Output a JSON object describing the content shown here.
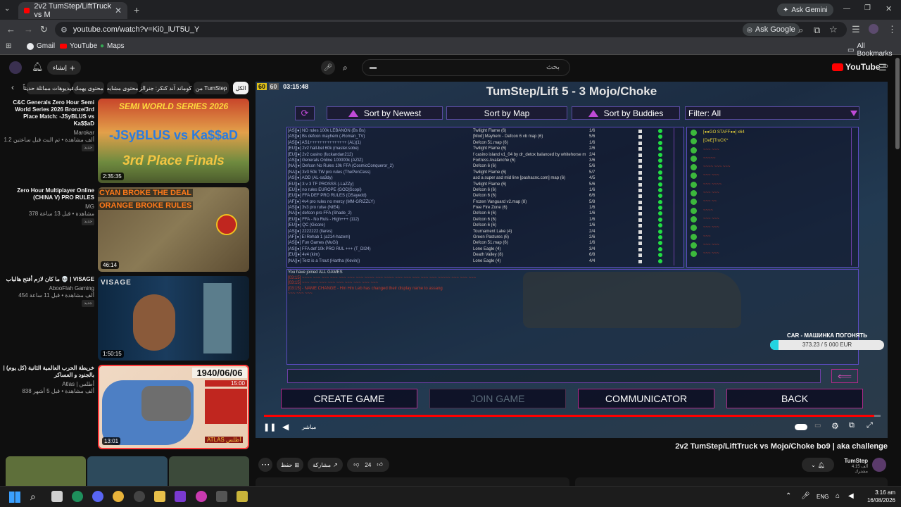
{
  "browser": {
    "tab_title": "2v2 TumStep/LiftTruck vs M",
    "tab_close": "✕",
    "new_tab": "+",
    "ask_gemini": "Ask Gemini",
    "url": "youtube.com/watch?v=Ki0_lUT5U_Y",
    "ask_google": "Ask Google",
    "bookmarks": [
      "Gmail",
      "YouTube",
      "Maps"
    ],
    "all_bookmarks": "All Bookmarks",
    "window_controls": [
      "—",
      "❐",
      "✕"
    ]
  },
  "youtube": {
    "create_label": "إنشاء",
    "search_placeholder": "بحث",
    "logo_text": "YouTube",
    "logo_sup": "JO",
    "chips": [
      "الكل",
      "من TumStep",
      "كوماند آند كنكر: جنرالز",
      "محتوى مشابه",
      "محتوى يهمك",
      "فيديوهات مماثلة حديثاً"
    ],
    "recommendations": [
      {
        "title": "C&C Generals Zero Hour Semi World Series 2026 Bronze/3rd Place Match: -JSyBLUS vs Ka$$aD",
        "channel": "Marokar",
        "stats": "1.2 ألف مشاهدة • تم البث قبل ساعتين",
        "badge": "جديد",
        "duration": "2:35:35",
        "thumb_top": "SEMI WORLD SERIES 2026",
        "thumb_mid": "-JSyBLUS vs Ka$$aD",
        "thumb_bottom": "3rd Place Finals"
      },
      {
        "title": "Zero Hour Multiplayer Online (CHINA V) PRO RULES",
        "channel": "MG",
        "stats": "378 مشاهدة • قبل 13 ساعة",
        "badge": "جديد",
        "duration": "46:14",
        "thumb_top": "CYAN BROKE THE DEAL",
        "thumb_mid": "ORANGE BROKE RULES"
      },
      {
        "title": "ما كان لازم أفتح هالباب 💀 | VISAGE",
        "channel": "AbooFlah Gaming",
        "stats": "454 ألف مشاهدة • قبل 11 ساعة",
        "badge": "جديد",
        "duration": "1:50:15",
        "thumb_top": "VISAGE"
      },
      {
        "title": "خريطة الحرب العالمية الثانية (كل يوم) | بالجنود و العساكر",
        "channel": "Atlas | أطلس",
        "stats": "838 ألف مشاهدة • قبل 5 أشهر",
        "duration": "13:01",
        "thumb_date": "1940/06/06",
        "thumb_time": "15:00",
        "thumb_label": "ATLAS أطلس"
      }
    ],
    "video_title": "2v2 TumStep/LiftTruck vs Mojo/Choke bo9 | aka challenge",
    "channel_name": "TumStep",
    "subscribers": "4.15 ألف مشترك",
    "likes": "24",
    "share": "مشاركة",
    "save": "حفظ",
    "more": "⋯",
    "live_label": "مباشر"
  },
  "player": {
    "hud_a": "60",
    "hud_b": "60",
    "hud_time": "03:15:48",
    "progress_fraction": 0.99
  },
  "game": {
    "title": "TumStep/Lift 5 - 3 Mojo/Choke",
    "sort_newest": "Sort by Newest",
    "sort_map": "Sort by Map",
    "sort_buddies": "Sort by Buddies",
    "filter": "Filter: All",
    "games": [
      [
        "[AS][●] NO rules 100k LEBANON (Bs Bs)",
        "Twilight Flame (6)",
        "1/6"
      ],
      [
        "[AS][●] Bs defcon mayhem (-Roman_TV)",
        "[Mod] Mayhem - Defcon 6 vb map (6)",
        "5/6"
      ],
      [
        "[AS][●] AS1+++++++++++++++ (AL)(1)",
        "Defcon 51.map (6)",
        "1/6"
      ],
      [
        "[EU][●] 2v2 hall-bel 60k (master.sobe)",
        "Twilight Flame (6)",
        "2/6"
      ],
      [
        "[EU][●] 2v2 casino (fuckandan212)",
        "f casino island v1_04 by dr_detox balanced by whitehorse m",
        "2/4"
      ],
      [
        "[AS][●] Generals Online 100000k (AZIZ)",
        "Fortress Avalanche (6)",
        "3/6"
      ],
      [
        "[NA][●] Defcon No Rules 10k FFA (CosmicConqueror_2)",
        "Defcon 6 (6)",
        "5/6"
      ],
      [
        "[NA][●] 3v3 50k TW pro rules (ThePenCess)",
        "Twilight Flame (6)",
        "5/7"
      ],
      [
        "[AS][●] AOD (AL-sa3dy)",
        "asd a super asd mid line [pashacnc.com] map (6)",
        "4/5"
      ],
      [
        "[EU][●] 3 v 3 TF PROSSS (-LaZZy)",
        "Twilight Flame (6)",
        "5/6"
      ],
      [
        "[EU][●] no rules EUROPE (GOD]Scopi)",
        "Defcon 6 (6)",
        "1/6"
      ],
      [
        "[EU][●] FFA DEF PRO RULES (OSayedd)",
        "Defcon 6 (6)",
        "6/6"
      ],
      [
        "[AF][●] 4v4 pro rules no mercy (MM-GRIZZLY)",
        "Frozen Vanguard v2.map (8)",
        "5/8"
      ],
      [
        "[AS][●] 3v3 pro rulse (NIE4)",
        "Free Fire Zone (6)",
        "1/6"
      ],
      [
        "[NA][●] defcon pro FFA (Shade_2)",
        "Defcon 6 (6)",
        "1/6"
      ],
      [
        "[EU][●] FFA - No Ruls - High+++ (112)",
        "Defcon 6 (6)",
        "1/6"
      ],
      [
        "[EU][●] QC (Gicore)",
        "Defcon 6 (6)",
        "1/6"
      ],
      [
        "[AS][●] 2222222 (llares)",
        "Tournament Lake (4)",
        "2/4"
      ],
      [
        "[AF][●] El Rehab 1 (a214-hazem)",
        "Green Pastures (6)",
        "2/6"
      ],
      [
        "[AS][●] Fun Games (MuGi)",
        "Defcon 51.map (6)",
        "1/6"
      ],
      [
        "[AS][●] FFA def 10k PRO RUL +++ (T_DI24)",
        "Lone Eagle (4)",
        "3/4"
      ],
      [
        "[EU][●] 4v4 (kim)",
        "Death Valley (8)",
        "6/8"
      ],
      [
        "[NA][●] Terz is a Trout (Hartha (Kevin))",
        "Lone Eagle (4)",
        "4/4"
      ]
    ],
    "buddies": [
      "[●●GO STAFF●●] x64",
      "[OeE]TruCK^",
      "~~~ ~~~",
      "~~~~~",
      "~~~~ ~~~ ~~~",
      "~~~ ~~~",
      "~~~ ~~~~",
      "~~~ ~~~",
      "~~~ ~~",
      "~~~~",
      "~~~ ~~~",
      "~~~ ~~~",
      "~~~",
      "~~~ ~~~",
      "~~~ ~~~"
    ],
    "chat_lines": [
      {
        "text": "You have joined ALL GAMES",
        "color": "#d8d8d8"
      },
      {
        "text": "[03:15] ~~~~ ~~~ ~~~ ~~~ ~~~ ~~~ ~~~ ~~~~ ~~~ ~~~~ ~~~ ~~~ ~~~ ~~~ ~~~ ~~~~~ ~~~ ~~~ ~~~",
        "color": "#c0392b"
      },
      {
        "text": "[03:15] ~~~ ~~~ ~~~ ~~~ ~~~ ~~~ ~~~ ~~~ ~~~",
        "color": "#c0392b"
      },
      {
        "text": "[03:15] - NAME CHANGE - Hm Hm Leb has changed their display name to assang",
        "color": "#c0392b"
      },
      {
        "text": "~~~ ~~~ ~~~",
        "color": "#c0392b"
      }
    ],
    "btn_create": "CREATE GAME",
    "btn_join": "JOIN GAME",
    "btn_comm": "COMMUNICATOR",
    "btn_back": "BACK",
    "send_icon": "⟸",
    "notif_title": "CAR - МАШИНКА ПОГОНЯТЬ",
    "notif_amount": "373.23 / 5 000 EUR",
    "notif_fraction": 0.075
  },
  "taskbar": {
    "lang": "ENG",
    "time": "3:16 am",
    "date": "16/08/2026"
  }
}
